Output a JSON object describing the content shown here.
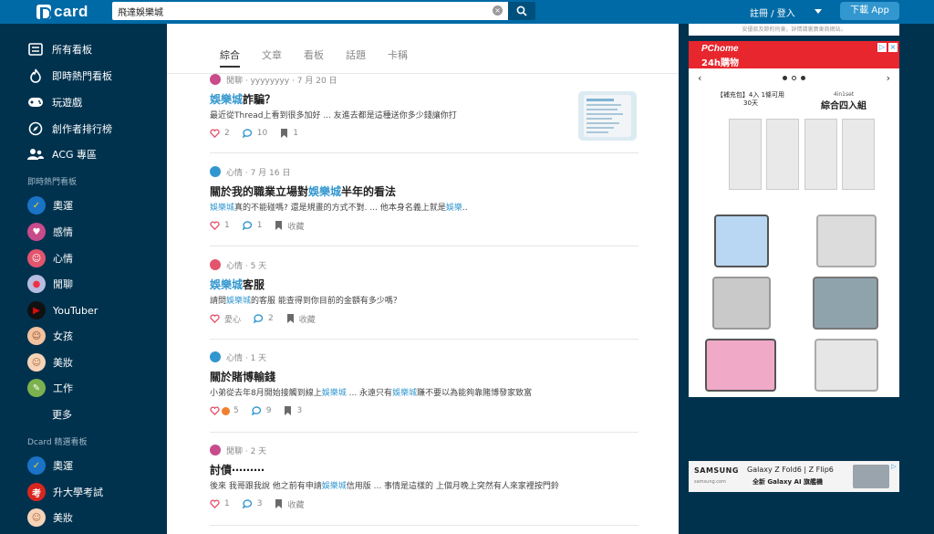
{
  "header": {
    "logo_text": "card",
    "search_value": "飛達娛樂城",
    "login_label": "註冊 / 登入",
    "download_label": "下載 App"
  },
  "sidebar": {
    "nav": [
      {
        "label": "所有看板",
        "icon": "list-icon"
      },
      {
        "label": "即時熱門看板",
        "icon": "flame-icon"
      },
      {
        "label": "玩遊戲",
        "icon": "gamepad-icon"
      },
      {
        "label": "創作者排行榜",
        "icon": "compass-icon"
      },
      {
        "label": "ACG 專區",
        "icon": "people-icon"
      }
    ],
    "hot_title": "即時熱門看板",
    "hot_boards": [
      {
        "label": "奧運",
        "color": "#1a73c6"
      },
      {
        "label": "感情",
        "color": "#c84b8c"
      },
      {
        "label": "心情",
        "color": "#e2556d"
      },
      {
        "label": "閒聊",
        "color": "#b7bde0"
      },
      {
        "label": "YouTuber",
        "color": "#e00b0b"
      },
      {
        "label": "女孩",
        "color": "#f3c29f"
      },
      {
        "label": "美妝",
        "color": "#f5d4b7"
      },
      {
        "label": "工作",
        "color": "#7bb24f"
      }
    ],
    "more_label": "更多",
    "featured_title": "Dcard 精選看板",
    "featured_boards": [
      {
        "label": "奧運",
        "color": "#1a73c6"
      },
      {
        "label": "升大學考試",
        "color": "#d8261f"
      },
      {
        "label": "美妝",
        "color": "#f5d4b7"
      }
    ]
  },
  "tabs": [
    "綜合",
    "文章",
    "看板",
    "話題",
    "卡稱"
  ],
  "posts": [
    {
      "meta": "閒聊 · yyyyyyyy · 7 月 20 日",
      "title_hl": "娛樂城",
      "title_rest": "詐騙？",
      "excerpt": "最近從Thread上看到很多加好 ... 友進去都是這種送你多少錢讓你打",
      "likes": "2",
      "comments": "10",
      "saves": "1"
    },
    {
      "meta": "心情 · 7 月 16 日",
      "title_pre": "關於我的職業立場對",
      "title_hl": "娛樂城",
      "title_post": "半年的看法",
      "excerpt_hl": "娛樂城",
      "excerpt_mid": "真的不能碰嗎? 還是規畫的方式不對. ... 他本身名義上就是",
      "excerpt_hl2": "娛樂",
      "excerpt_end": "..",
      "likes": "1",
      "comments": "1",
      "saves": "收藏"
    },
    {
      "meta": "心情 · 5 天",
      "title_hl": "娛樂城",
      "title_rest": "客服",
      "excerpt_pre": "請問",
      "excerpt_hl": "娛樂城",
      "excerpt_post": "的客服 能查得到你目前的金額有多少嗎？",
      "likes": "愛心",
      "comments": "2",
      "saves": "收藏"
    },
    {
      "meta": "心情 · 1 天",
      "title": "關於賭博輸錢",
      "excerpt_pre": "小弟從去年8月開始接觸到線上",
      "excerpt_hl": "娛樂城",
      "excerpt_mid": " ... 永遠只有",
      "excerpt_hl2": "娛樂城",
      "excerpt_post": "賺不要以為能夠靠賭博發家致富",
      "likes": "5",
      "comments": "9",
      "saves": "3"
    },
    {
      "meta": "閒聊 · 2 天",
      "title": "討債⋯⋯⋯",
      "excerpt_pre": "後來 我哥跟我說 他之前有申請",
      "excerpt_hl": "娛樂城",
      "excerpt_post": "信用版 ... 事情是這樣的 上個月晚上突然有人來家裡按門鈴",
      "likes": "1",
      "comments": "3",
      "saves": "收藏"
    }
  ],
  "ads": {
    "top_notice": "安優款及節約刑東，詳情請裏廣東商網站。",
    "pchome_brand": "PChome",
    "pchome_sub": "24h購物",
    "promo_left": "【補充包】4入 1條可用30天",
    "promo_right_small": "4in1set",
    "promo_right": "綜合四入組",
    "samsung_brand": "SAMSUNG",
    "samsung_product": "Galaxy Z Fold6 | Z Flip6",
    "samsung_sub": "全新 Galaxy AI 旗艦機",
    "samsung_site": "samsung.com"
  }
}
